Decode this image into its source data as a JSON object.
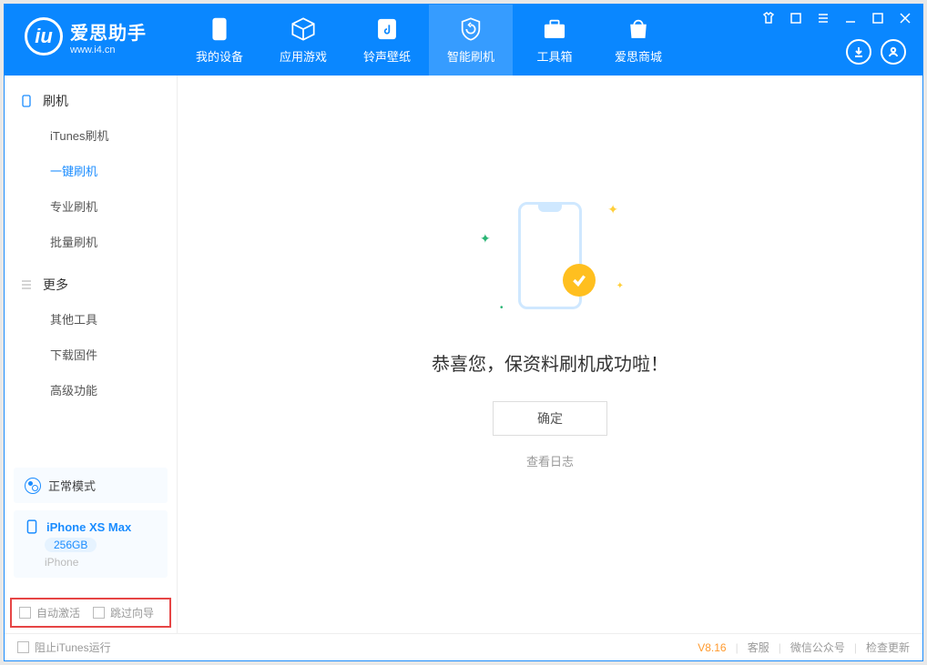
{
  "app": {
    "title": "爱思助手",
    "subtitle": "www.i4.cn"
  },
  "tabs": {
    "device": "我的设备",
    "apps": "应用游戏",
    "rings": "铃声壁纸",
    "flash": "智能刷机",
    "tools": "工具箱",
    "store": "爱思商城"
  },
  "sidebar": {
    "group_flash": "刷机",
    "items_flash": {
      "itunes": "iTunes刷机",
      "onekey": "一键刷机",
      "pro": "专业刷机",
      "batch": "批量刷机"
    },
    "group_more": "更多",
    "items_more": {
      "other": "其他工具",
      "firmware": "下载固件",
      "adv": "高级功能"
    }
  },
  "mode": {
    "label": "正常模式"
  },
  "device": {
    "name": "iPhone XS Max",
    "capacity": "256GB",
    "sub": "iPhone"
  },
  "checks": {
    "auto_activate": "自动激活",
    "skip_guide": "跳过向导"
  },
  "main": {
    "success": "恭喜您，保资料刷机成功啦！",
    "ok": "确定",
    "view_log": "查看日志"
  },
  "status": {
    "block_itunes": "阻止iTunes运行",
    "version": "V8.16",
    "kefu": "客服",
    "wechat": "微信公众号",
    "update": "检查更新"
  }
}
